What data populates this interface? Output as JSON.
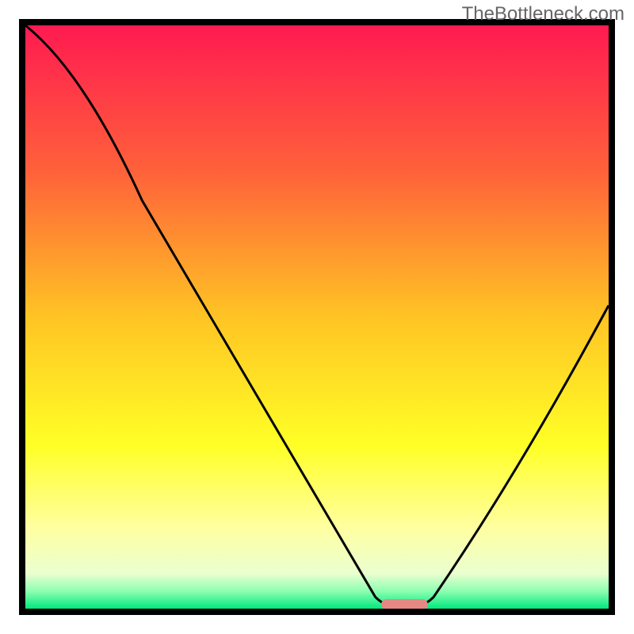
{
  "watermark": "TheBottleneck.com",
  "chart_data": {
    "type": "line",
    "title": "",
    "xlabel": "",
    "ylabel": "",
    "xlim": [
      0,
      100
    ],
    "ylim": [
      0,
      100
    ],
    "x": [
      0,
      20,
      60,
      62,
      68,
      70,
      100
    ],
    "y": [
      100,
      70,
      2,
      0,
      0,
      2,
      52
    ],
    "gradient_stops": [
      {
        "offset": 0.0,
        "color": "#ff1a51"
      },
      {
        "offset": 0.25,
        "color": "#ff613a"
      },
      {
        "offset": 0.5,
        "color": "#ffc424"
      },
      {
        "offset": 0.72,
        "color": "#ffff26"
      },
      {
        "offset": 0.86,
        "color": "#ffffa0"
      },
      {
        "offset": 0.94,
        "color": "#eaffd0"
      },
      {
        "offset": 0.97,
        "color": "#8cffb0"
      },
      {
        "offset": 1.0,
        "color": "#00e97e"
      }
    ],
    "optimal_marker": {
      "x_start": 61,
      "x_end": 69,
      "color": "#e58884"
    },
    "curve_color": "#000000",
    "border_color": "#000000"
  }
}
